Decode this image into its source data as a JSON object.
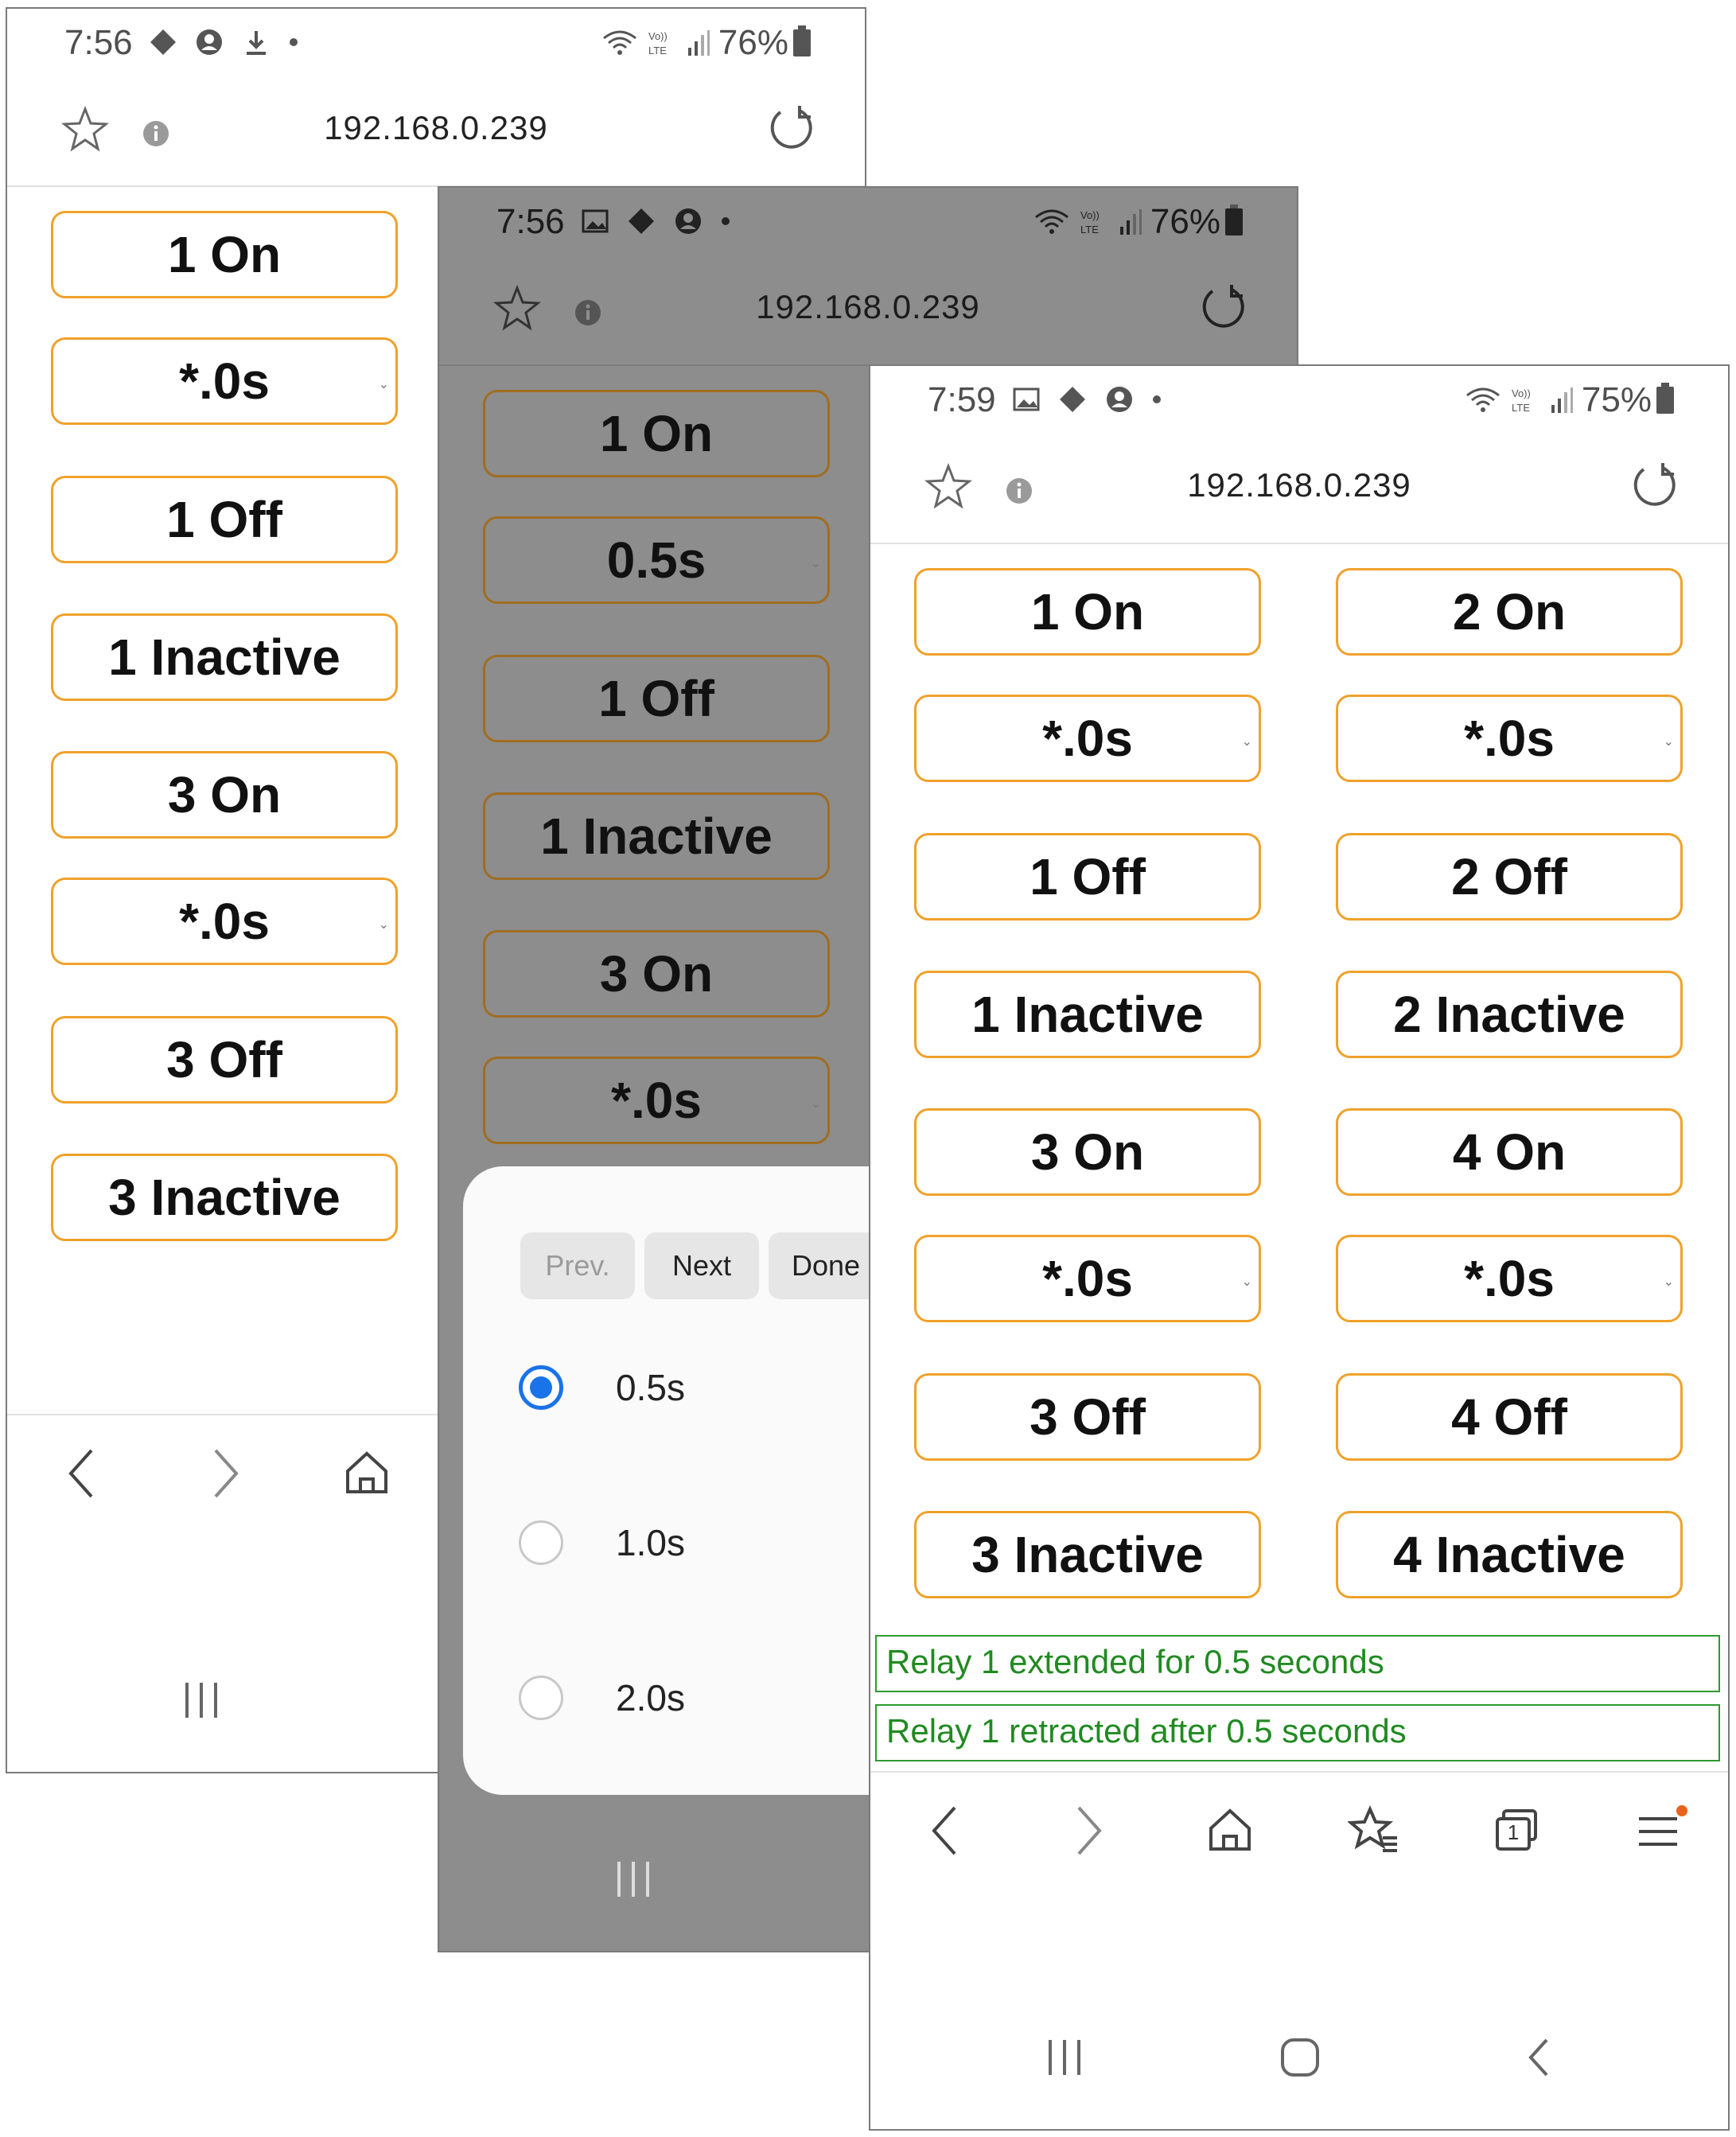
{
  "colors": {
    "accent": "#f0a12b",
    "log_text": "#218a21",
    "dim_overlay": "#8d8d8d",
    "radio_selected": "#1a73e8"
  },
  "url": "192.168.0.239",
  "screen1": {
    "time": "7:56",
    "battery": "76%",
    "buttons": [
      "1 On",
      "*.0s",
      "1 Off",
      "1 Inactive",
      "3 On",
      "*.0s",
      "3 Off",
      "3 Inactive"
    ]
  },
  "screen2": {
    "time": "7:56",
    "battery": "76%",
    "buttons": [
      "1 On",
      "0.5s",
      "1 Off",
      "1 Inactive",
      "3 On",
      "*.0s"
    ],
    "picker": {
      "prev": "Prev.",
      "next": "Next",
      "done": "Done",
      "options": [
        "0.5s",
        "1.0s",
        "2.0s"
      ],
      "selected": "0.5s"
    }
  },
  "screen3": {
    "time": "7:59",
    "battery": "75%",
    "left_buttons": [
      "1 On",
      "*.0s",
      "1 Off",
      "1 Inactive",
      "3 On",
      "*.0s",
      "3 Off",
      "3 Inactive"
    ],
    "right_buttons": [
      "2 On",
      "*.0s",
      "2 Off",
      "2 Inactive",
      "4 On",
      "*.0s",
      "4 Off",
      "4 Inactive"
    ],
    "log": [
      "Relay 1 extended for 0.5 seconds",
      "Relay 1 retracted after 0.5 seconds"
    ],
    "tab_count": "1"
  }
}
